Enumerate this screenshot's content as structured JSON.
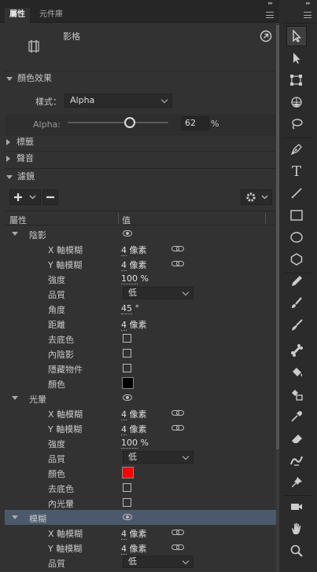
{
  "tabs": {
    "properties": "屬性",
    "library": "元件庫"
  },
  "object": {
    "type_label": "影格"
  },
  "color_effect": {
    "header": "顏色效果",
    "style_label": "樣式：",
    "style_value": "Alpha",
    "alpha_label": "Alpha:",
    "alpha_value": "62",
    "alpha_unit": "%",
    "alpha_fraction": 0.62
  },
  "sections": {
    "label": "標籤",
    "sound": "聲音",
    "filters": "濾鏡"
  },
  "filter_table": {
    "col_property": "屬性",
    "col_value": "值"
  },
  "filters": {
    "drop_shadow": {
      "name": "陰影",
      "x_blur_label": "X 軸模糊",
      "x_blur": "4",
      "y_blur_label": "Y 軸模糊",
      "y_blur": "4",
      "unit": "像素",
      "strength_label": "強度",
      "strength": "100",
      "strength_unit": "%",
      "quality_label": "品質",
      "quality": "低",
      "angle_label": "角度",
      "angle": "45",
      "angle_unit": "°",
      "distance_label": "距離",
      "distance": "4",
      "distance_unit": "像素",
      "knockout_label": "去底色",
      "inner_shadow_label": "內陰影",
      "hide_object_label": "隱藏物件",
      "color_label": "顏色",
      "color": "#000000"
    },
    "glow": {
      "name": "光暈",
      "x_blur_label": "X 軸模糊",
      "x_blur": "4",
      "y_blur_label": "Y 軸模糊",
      "y_blur": "4",
      "unit": "像素",
      "strength_label": "強度",
      "strength": "100",
      "strength_unit": "%",
      "quality_label": "品質",
      "quality": "低",
      "color_label": "顏色",
      "color": "#ff0000",
      "knockout_label": "去底色",
      "inner_glow_label": "內光暈"
    },
    "blur": {
      "name": "模糊",
      "x_blur_label": "X 軸模糊",
      "x_blur": "4",
      "y_blur_label": "Y 軸模糊",
      "y_blur": "4",
      "unit": "像素",
      "quality_label": "品質",
      "quality": "低"
    }
  },
  "toolbar_icons": [
    "selection-tool-icon",
    "subselection-tool-icon",
    "free-transform-tool-icon",
    "3d-rotation-tool-icon",
    "lasso-tool-icon",
    "pen-tool-icon",
    "text-tool-icon",
    "line-tool-icon",
    "rectangle-tool-icon",
    "oval-tool-icon",
    "polystar-tool-icon",
    "pencil-tool-icon",
    "paint-brush-tool-icon",
    "brush-tool-icon",
    "bone-tool-icon",
    "paint-bucket-tool-icon",
    "ink-bottle-tool-icon",
    "eyedropper-tool-icon",
    "eraser-tool-icon",
    "width-tool-icon",
    "pin-tool-icon",
    "camera-tool-icon",
    "hand-tool-icon",
    "zoom-tool-icon"
  ]
}
